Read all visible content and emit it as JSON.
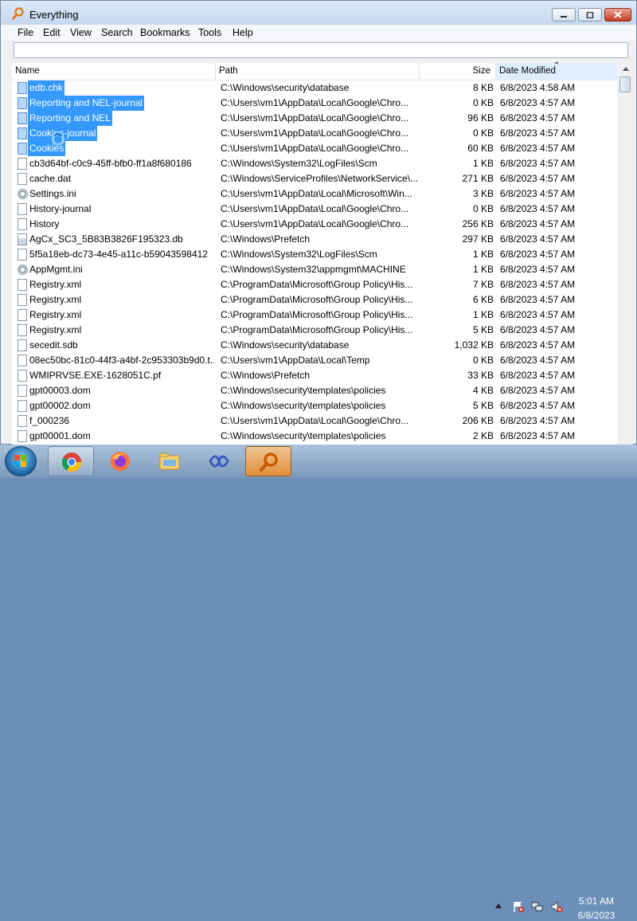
{
  "window": {
    "title": "Everything"
  },
  "menu": [
    "File",
    "Edit",
    "View",
    "Search",
    "Bookmarks",
    "Tools",
    "Help"
  ],
  "search": {
    "value": ""
  },
  "columns": {
    "name": "Name",
    "path": "Path",
    "size": "Size",
    "date": "Date Modified"
  },
  "rows": [
    {
      "name": "edb.chk",
      "path": "C:\\Windows\\security\\database",
      "size": "8 KB",
      "date": "6/8/2023 4:58 AM",
      "selected": true,
      "icon": "db"
    },
    {
      "name": "Reporting and NEL-journal",
      "path": "C:\\Users\\vm1\\AppData\\Local\\Google\\Chro...",
      "size": "0 KB",
      "date": "6/8/2023 4:57 AM",
      "selected": true,
      "icon": "file"
    },
    {
      "name": "Reporting and NEL",
      "path": "C:\\Users\\vm1\\AppData\\Local\\Google\\Chro...",
      "size": "96 KB",
      "date": "6/8/2023 4:57 AM",
      "selected": true,
      "icon": "file"
    },
    {
      "name": "Cookies-journal",
      "path": "C:\\Users\\vm1\\AppData\\Local\\Google\\Chro...",
      "size": "0 KB",
      "date": "6/8/2023 4:57 AM",
      "selected": true,
      "icon": "file"
    },
    {
      "name": "Cookies",
      "path": "C:\\Users\\vm1\\AppData\\Local\\Google\\Chro...",
      "size": "60 KB",
      "date": "6/8/2023 4:57 AM",
      "selected": true,
      "icon": "file"
    },
    {
      "name": "cb3d64bf-c0c9-45ff-bfb0-ff1a8f680186",
      "path": "C:\\Windows\\System32\\LogFiles\\Scm",
      "size": "1 KB",
      "date": "6/8/2023 4:57 AM",
      "selected": false,
      "icon": "file"
    },
    {
      "name": "cache.dat",
      "path": "C:\\Windows\\ServiceProfiles\\NetworkService\\...",
      "size": "271 KB",
      "date": "6/8/2023 4:57 AM",
      "selected": false,
      "icon": "file"
    },
    {
      "name": "Settings.ini",
      "path": "C:\\Users\\vm1\\AppData\\Local\\Microsoft\\Win...",
      "size": "3 KB",
      "date": "6/8/2023 4:57 AM",
      "selected": false,
      "icon": "gear"
    },
    {
      "name": "History-journal",
      "path": "C:\\Users\\vm1\\AppData\\Local\\Google\\Chro...",
      "size": "0 KB",
      "date": "6/8/2023 4:57 AM",
      "selected": false,
      "icon": "file"
    },
    {
      "name": "History",
      "path": "C:\\Users\\vm1\\AppData\\Local\\Google\\Chro...",
      "size": "256 KB",
      "date": "6/8/2023 4:57 AM",
      "selected": false,
      "icon": "file"
    },
    {
      "name": "AgCx_SC3_5B83B3826F195323.db",
      "path": "C:\\Windows\\Prefetch",
      "size": "297 KB",
      "date": "6/8/2023 4:57 AM",
      "selected": false,
      "icon": "db"
    },
    {
      "name": "5f5a18eb-dc73-4e45-a11c-b59043598412",
      "path": "C:\\Windows\\System32\\LogFiles\\Scm",
      "size": "1 KB",
      "date": "6/8/2023 4:57 AM",
      "selected": false,
      "icon": "file"
    },
    {
      "name": "AppMgmt.ini",
      "path": "C:\\Windows\\System32\\appmgmt\\MACHINE",
      "size": "1 KB",
      "date": "6/8/2023 4:57 AM",
      "selected": false,
      "icon": "gear"
    },
    {
      "name": "Registry.xml",
      "path": "C:\\ProgramData\\Microsoft\\Group Policy\\His...",
      "size": "7 KB",
      "date": "6/8/2023 4:57 AM",
      "selected": false,
      "icon": "file"
    },
    {
      "name": "Registry.xml",
      "path": "C:\\ProgramData\\Microsoft\\Group Policy\\His...",
      "size": "6 KB",
      "date": "6/8/2023 4:57 AM",
      "selected": false,
      "icon": "file"
    },
    {
      "name": "Registry.xml",
      "path": "C:\\ProgramData\\Microsoft\\Group Policy\\His...",
      "size": "1 KB",
      "date": "6/8/2023 4:57 AM",
      "selected": false,
      "icon": "file"
    },
    {
      "name": "Registry.xml",
      "path": "C:\\ProgramData\\Microsoft\\Group Policy\\His...",
      "size": "5 KB",
      "date": "6/8/2023 4:57 AM",
      "selected": false,
      "icon": "file"
    },
    {
      "name": "secedit.sdb",
      "path": "C:\\Windows\\security\\database",
      "size": "1,032 KB",
      "date": "6/8/2023 4:57 AM",
      "selected": false,
      "icon": "file"
    },
    {
      "name": "08ec50bc-81c0-44f3-a4bf-2c953303b9d0.t...",
      "path": "C:\\Users\\vm1\\AppData\\Local\\Temp",
      "size": "0 KB",
      "date": "6/8/2023 4:57 AM",
      "selected": false,
      "icon": "file"
    },
    {
      "name": "WMIPRVSE.EXE-1628051C.pf",
      "path": "C:\\Windows\\Prefetch",
      "size": "33 KB",
      "date": "6/8/2023 4:57 AM",
      "selected": false,
      "icon": "file"
    },
    {
      "name": "gpt00003.dom",
      "path": "C:\\Windows\\security\\templates\\policies",
      "size": "4 KB",
      "date": "6/8/2023 4:57 AM",
      "selected": false,
      "icon": "file"
    },
    {
      "name": "gpt00002.dom",
      "path": "C:\\Windows\\security\\templates\\policies",
      "size": "5 KB",
      "date": "6/8/2023 4:57 AM",
      "selected": false,
      "icon": "file"
    },
    {
      "name": "f_000236",
      "path": "C:\\Users\\vm1\\AppData\\Local\\Google\\Chro...",
      "size": "206 KB",
      "date": "6/8/2023 4:57 AM",
      "selected": false,
      "icon": "file"
    },
    {
      "name": "gpt00001.dom",
      "path": "C:\\Windows\\security\\templates\\policies",
      "size": "2 KB",
      "date": "6/8/2023 4:57 AM",
      "selected": false,
      "icon": "file"
    }
  ],
  "taskbar": {
    "apps": [
      "chrome-icon",
      "firefox-icon",
      "file-explorer-icon",
      "visual-studio-icon",
      "everything-icon"
    ],
    "clock_time": "5:01 AM",
    "clock_date": "6/8/2023"
  },
  "colors": {
    "selection": "#3399ff",
    "accent_active": "#e08f3d"
  }
}
